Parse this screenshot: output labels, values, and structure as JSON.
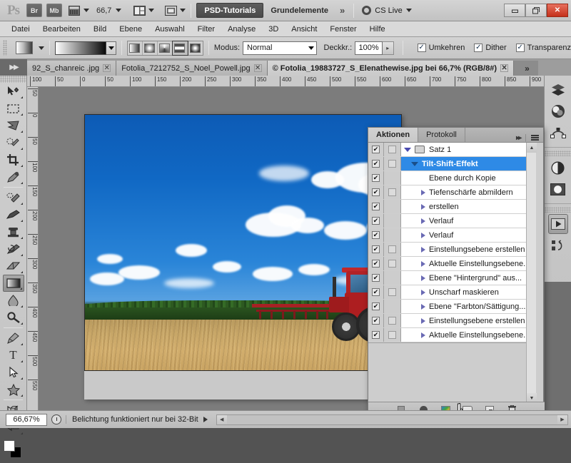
{
  "appbar": {
    "logo": "Ps",
    "bridge_label": "Br",
    "minibridge_label": "Mb",
    "zoom_value": "66,7",
    "workspace_active": "PSD-Tutorials",
    "workspace_other": "Grundelemente",
    "overflow": "»",
    "cs_live": "CS Live",
    "minimize": "–",
    "restore": "❐",
    "close": "✕"
  },
  "menubar": {
    "items": [
      "Datei",
      "Bearbeiten",
      "Bild",
      "Ebene",
      "Auswahl",
      "Filter",
      "Analyse",
      "3D",
      "Ansicht",
      "Fenster",
      "Hilfe"
    ]
  },
  "optionsbar": {
    "mode_label": "Modus:",
    "mode_value": "Normal",
    "opacity_label": "Deckkr.:",
    "opacity_value": "100%",
    "checkboxes": [
      {
        "label": "Umkehren",
        "checked": true
      },
      {
        "label": "Dither",
        "checked": true
      },
      {
        "label": "Transparenz",
        "checked": true
      }
    ],
    "gradient_types": [
      "linear",
      "radial",
      "angular",
      "reflected",
      "diamond"
    ],
    "gradient_selected_index": 3
  },
  "tabs": {
    "items": [
      {
        "label": "92_S_chanreic .jpg",
        "active": false
      },
      {
        "label": "Fotolia_7212752_S_Noel_Powell.jpg",
        "active": false
      },
      {
        "label": "© Fotolia_19883727_S_Elenathewise.jpg bei 66,7% (RGB/8#)",
        "active": true
      }
    ],
    "overflow": "»"
  },
  "toolbox": {
    "tools": [
      {
        "name": "move-tool",
        "selected": false
      },
      {
        "name": "marquee-tool",
        "selected": false
      },
      {
        "name": "lasso-tool",
        "selected": false
      },
      {
        "name": "quick-selection-tool",
        "selected": false
      },
      {
        "name": "crop-tool",
        "selected": false
      },
      {
        "name": "eyedropper-tool",
        "selected": false
      },
      {
        "name": "healing-brush-tool",
        "selected": false
      },
      {
        "name": "brush-tool",
        "selected": false
      },
      {
        "name": "clone-stamp-tool",
        "selected": false
      },
      {
        "name": "history-brush-tool",
        "selected": false
      },
      {
        "name": "eraser-tool",
        "selected": false
      },
      {
        "name": "gradient-tool",
        "selected": true
      },
      {
        "name": "blur-tool",
        "selected": false
      },
      {
        "name": "dodge-tool",
        "selected": false
      },
      {
        "name": "pen-tool",
        "selected": false
      },
      {
        "name": "type-tool",
        "selected": false
      },
      {
        "name": "path-selection-tool",
        "selected": false
      },
      {
        "name": "shape-tool",
        "selected": false
      },
      {
        "name": "rotate-3d-tool",
        "selected": false
      },
      {
        "name": "camera-3d-tool",
        "selected": false
      }
    ],
    "foreground_color": "#ffffff",
    "background_color": "#000000"
  },
  "rulers": {
    "horizontal_ticks": [
      "100",
      "50",
      "0",
      "50",
      "100",
      "150",
      "200",
      "250",
      "300",
      "350",
      "400",
      "450",
      "500",
      "550",
      "600",
      "650",
      "700",
      "750",
      "800",
      "850",
      "900"
    ],
    "vertical_ticks": [
      "50",
      "0",
      "50",
      "100",
      "150",
      "200",
      "250",
      "300",
      "350",
      "400",
      "450",
      "500",
      "550"
    ]
  },
  "document": {
    "scene": "tractor-plowing-field-under-blue-sky",
    "zoom": "66,67%"
  },
  "right_dock": {
    "icons": [
      {
        "name": "layers-icon",
        "selected": false
      },
      {
        "name": "color-icon",
        "selected": false
      },
      {
        "name": "paths-icon",
        "selected": false
      },
      {
        "name": "adjustments-icon",
        "selected": false
      },
      {
        "name": "masks-icon",
        "selected": false
      },
      {
        "name": "actions-icon",
        "selected": true
      },
      {
        "name": "history-icon",
        "selected": false
      }
    ]
  },
  "actions_panel": {
    "tabs": [
      {
        "label": "Aktionen",
        "active": true
      },
      {
        "label": "Protokoll",
        "active": false
      }
    ],
    "collapse_icon": "▸▸",
    "rows": [
      {
        "label": "Satz 1",
        "checked": true,
        "dialog_box": true,
        "indent": 0,
        "toggle": "down",
        "icon": "folder",
        "selected": false
      },
      {
        "label": "Tilt-Shift-Effekt",
        "checked": true,
        "dialog_box": true,
        "indent": 1,
        "toggle": "down",
        "icon": "none",
        "selected": true
      },
      {
        "label": "Ebene durch Kopie",
        "checked": true,
        "dialog_box": false,
        "indent": 2,
        "toggle": "none",
        "icon": "none",
        "selected": false
      },
      {
        "label": "Tiefenschärfe abmildern",
        "checked": true,
        "dialog_box": true,
        "indent": 2,
        "toggle": "right",
        "icon": "none",
        "selected": false
      },
      {
        "label": "erstellen",
        "checked": true,
        "dialog_box": false,
        "indent": 2,
        "toggle": "right",
        "icon": "none",
        "selected": false
      },
      {
        "label": "Verlauf",
        "checked": true,
        "dialog_box": false,
        "indent": 2,
        "toggle": "right",
        "icon": "none",
        "selected": false
      },
      {
        "label": "Verlauf",
        "checked": true,
        "dialog_box": false,
        "indent": 2,
        "toggle": "right",
        "icon": "none",
        "selected": false
      },
      {
        "label": "Einstellungsebene erstellen",
        "checked": true,
        "dialog_box": true,
        "indent": 2,
        "toggle": "right",
        "icon": "none",
        "selected": false
      },
      {
        "label": "Aktuelle Einstellungsebene...",
        "checked": true,
        "dialog_box": true,
        "indent": 2,
        "toggle": "right",
        "icon": "none",
        "selected": false
      },
      {
        "label": "Ebene \"Hintergrund\" aus...",
        "checked": true,
        "dialog_box": false,
        "indent": 2,
        "toggle": "right",
        "icon": "none",
        "selected": false
      },
      {
        "label": "Unscharf maskieren",
        "checked": true,
        "dialog_box": true,
        "indent": 2,
        "toggle": "right",
        "icon": "none",
        "selected": false
      },
      {
        "label": "Ebene \"Farbton/Sättigung...",
        "checked": true,
        "dialog_box": false,
        "indent": 2,
        "toggle": "right",
        "icon": "none",
        "selected": false
      },
      {
        "label": "Einstellungsebene erstellen",
        "checked": true,
        "dialog_box": true,
        "indent": 2,
        "toggle": "right",
        "icon": "none",
        "selected": false
      },
      {
        "label": "Aktuelle Einstellungsebene...",
        "checked": true,
        "dialog_box": true,
        "indent": 2,
        "toggle": "right",
        "icon": "none",
        "selected": false
      }
    ],
    "footer_buttons": [
      "stop-button",
      "record-button",
      "play-button",
      "new-set-button",
      "new-action-button",
      "delete-button"
    ]
  },
  "statusbar": {
    "zoom": "66,67%",
    "message": "Belichtung funktioniert nur bei 32-Bit"
  },
  "colors": {
    "accent_selection": "#2e8ae6",
    "close_button": "#c4301b",
    "sky": "#1068c4",
    "field": "#c8a768",
    "tractor": "#b22226"
  }
}
